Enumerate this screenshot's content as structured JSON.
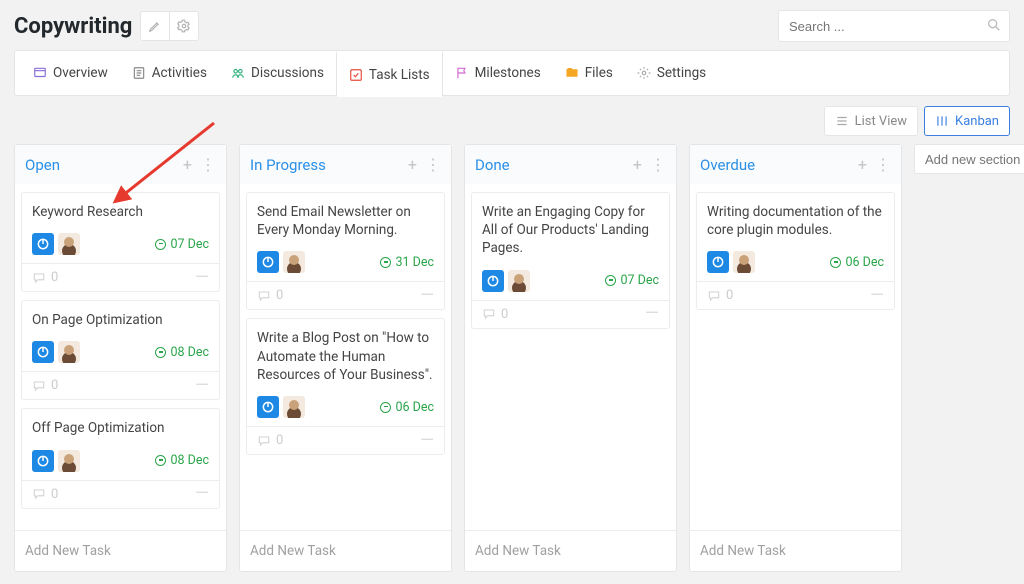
{
  "title": "Copywriting",
  "search_placeholder": "Search ...",
  "tabs": {
    "overview": "Overview",
    "activities": "Activities",
    "discussions": "Discussions",
    "task_lists": "Task Lists",
    "milestones": "Milestones",
    "files": "Files",
    "settings": "Settings"
  },
  "views": {
    "list": "List View",
    "kanban": "Kanban"
  },
  "add_section_placeholder": "Add new section",
  "add_task_label": "Add New Task",
  "columns": [
    {
      "title": "Open",
      "cards": [
        {
          "title": "Keyword Research",
          "date": "07 Dec",
          "comments": "0"
        },
        {
          "title": "On Page Optimization",
          "date": "08 Dec",
          "comments": "0"
        },
        {
          "title": "Off Page Optimization",
          "date": "08 Dec",
          "comments": "0"
        }
      ]
    },
    {
      "title": "In Progress",
      "cards": [
        {
          "title": "Send Email Newsletter on Every Monday Morning.",
          "date": "31 Dec",
          "comments": "0"
        },
        {
          "title": "Write a Blog Post on \"How to Automate the Human Resources of Your Business\".",
          "date": "06 Dec",
          "comments": "0"
        }
      ]
    },
    {
      "title": "Done",
      "cards": [
        {
          "title": "Write an Engaging Copy for All of Our Products' Landing Pages.",
          "date": "07 Dec",
          "comments": "0"
        }
      ]
    },
    {
      "title": "Overdue",
      "cards": [
        {
          "title": "Writing documentation of the core plugin modules.",
          "date": "06 Dec",
          "comments": "0"
        }
      ]
    }
  ]
}
